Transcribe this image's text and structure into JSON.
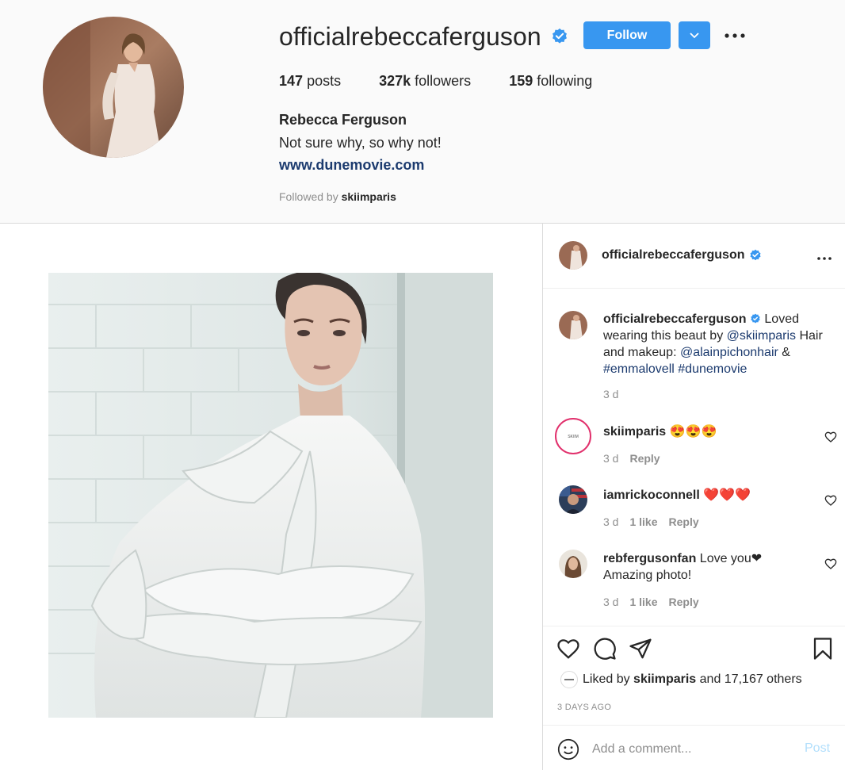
{
  "profile": {
    "username": "officialrebeccaferguson",
    "follow_label": "Follow",
    "stats": {
      "posts_count": "147",
      "posts_label": "posts",
      "followers_count": "327k",
      "followers_label": "followers",
      "following_count": "159",
      "following_label": "following"
    },
    "full_name": "Rebecca Ferguson",
    "bio": "Not sure why, so why not!",
    "website": "www.dunemovie.com",
    "followed_by_prefix": "Followed by",
    "followed_by_user": "skiimparis"
  },
  "post": {
    "author": "officialrebeccaferguson",
    "caption": {
      "author": "officialrebeccaferguson",
      "text_1": " Loved wearing this beaut by ",
      "mention_1": "@skiimparis",
      "text_2": " Hair and makeup: ",
      "mention_2": "@alainpichonhair",
      "text_3": " & ",
      "hashtag_1": "#emmalovell",
      "text_4": " ",
      "hashtag_2": "#dunemovie",
      "age": "3 d"
    },
    "comments": [
      {
        "user": "skiimparis",
        "text": " 😍😍😍",
        "age": "3 d",
        "likes": "",
        "reply": "Reply"
      },
      {
        "user": "iamrickoconnell",
        "text": " ❤️❤️❤️",
        "age": "3 d",
        "likes": "1 like",
        "reply": "Reply"
      },
      {
        "user": "rebfergusonfan",
        "text": " Love you❤ Amazing photo!",
        "age": "3 d",
        "likes": "1 like",
        "reply": "Reply"
      }
    ],
    "liked_by_prefix": "Liked by",
    "liked_by_user": "skiimparis",
    "liked_by_suffix": "and 17,167 others",
    "timestamp": "3 DAYS AGO",
    "comment_placeholder": "Add a comment...",
    "post_button": "Post"
  },
  "colors": {
    "accent": "#3897f0",
    "link": "#1b3a6e",
    "muted": "#8e8e8e"
  }
}
